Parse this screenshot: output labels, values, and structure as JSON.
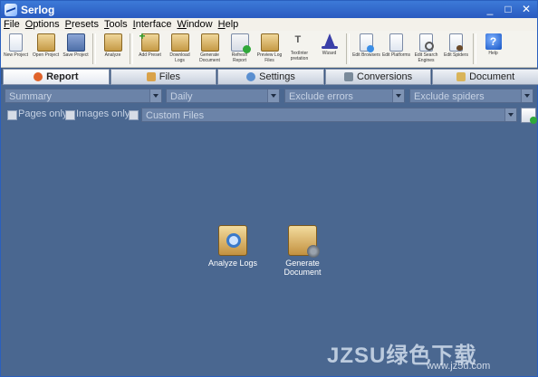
{
  "window": {
    "title": "Serlog",
    "controls": [
      "_",
      "□",
      "✕"
    ]
  },
  "menu": [
    "File",
    "Options",
    "Presets",
    "Tools",
    "Interface",
    "Window",
    "Help"
  ],
  "toolbar": [
    {
      "label": "New Project",
      "icon": "new-project-icon"
    },
    {
      "label": "Open Project",
      "icon": "open-project-icon"
    },
    {
      "label": "Save Project",
      "icon": "save-project-icon"
    },
    {
      "label": "Analyze",
      "icon": "analyze-icon"
    },
    {
      "label": "Add Preset",
      "icon": "add-preset-icon"
    },
    {
      "label": "Download Logs",
      "icon": "download-logs-icon"
    },
    {
      "label": "Generate Document",
      "icon": "generate-document-icon"
    },
    {
      "label": "Refresh Report",
      "icon": "refresh-report-icon"
    },
    {
      "label": "Preview Log Files",
      "icon": "preview-log-icon"
    },
    {
      "label": "TextInter pretation",
      "icon": "text-interpretation-icon"
    },
    {
      "label": "Wizard",
      "icon": "wizard-icon"
    },
    {
      "label": "Edit Browsers",
      "icon": "edit-browsers-icon"
    },
    {
      "label": "Edit Platforms",
      "icon": "edit-platforms-icon"
    },
    {
      "label": "Edit Search Engines",
      "icon": "edit-search-engines-icon"
    },
    {
      "label": "Edit Spiders",
      "icon": "edit-spiders-icon"
    },
    {
      "label": "Help",
      "icon": "help-icon"
    }
  ],
  "tabs": [
    {
      "label": "Report",
      "active": true,
      "color": "#e0632a"
    },
    {
      "label": "Files",
      "active": false,
      "color": "#d9a24a"
    },
    {
      "label": "Settings",
      "active": false,
      "color": "#5a8fd0"
    },
    {
      "label": "Conversions",
      "active": false,
      "color": "#7a8a9a"
    },
    {
      "label": "Document",
      "active": false,
      "color": "#d9b45a"
    }
  ],
  "filters": {
    "report_type": "Summary",
    "period": "Daily",
    "errors": "Exclude errors",
    "spiders": "Exclude spiders"
  },
  "checks": {
    "pages_only": "Pages only",
    "images_only": "Images only",
    "custom_files_placeholder": "Custom Files"
  },
  "actions": {
    "analyze_logs": "Analyze Logs",
    "generate_document": "Generate Document"
  },
  "watermark": {
    "main": "JZSU绿色下载",
    "sub": "www.jz5u.com"
  },
  "colors": {
    "background": "#4a6790",
    "titlebar": "#2a5bc0"
  }
}
